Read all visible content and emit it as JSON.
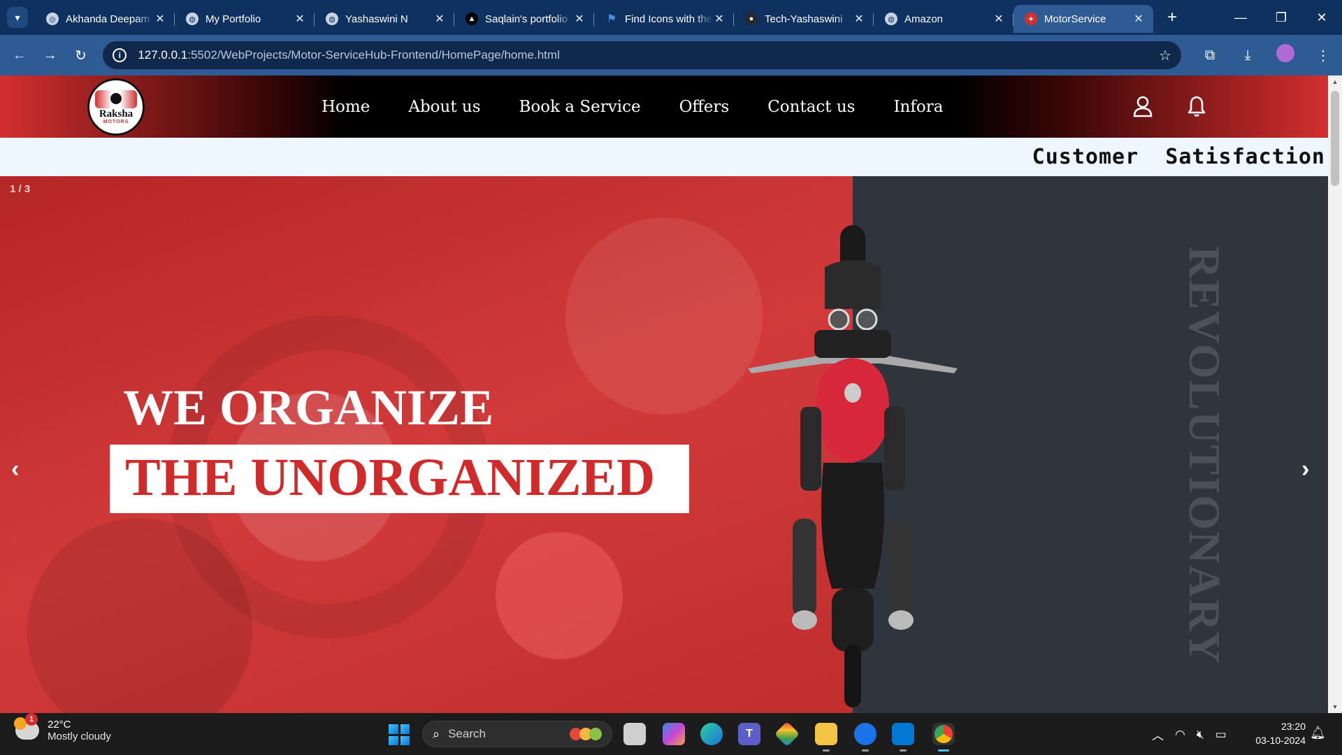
{
  "browser": {
    "tabs": [
      {
        "title": "Akhanda Deepam",
        "icon": "chatgpt-icon"
      },
      {
        "title": "My Portfolio",
        "icon": "globe-icon"
      },
      {
        "title": "Yashaswini N",
        "icon": "globe-icon"
      },
      {
        "title": "Saqlain's portfolio",
        "icon": "vercel-icon"
      },
      {
        "title": "Find Icons with the",
        "icon": "flag-icon"
      },
      {
        "title": "Tech-Yashaswini",
        "icon": "github-icon"
      },
      {
        "title": "Amazon",
        "icon": "globe-icon"
      },
      {
        "title": "MotorService",
        "icon": "site-logo-icon",
        "active": true
      }
    ],
    "url_host": "127.0.0.1",
    "url_rest": ":5502/WebProjects/Motor-ServiceHub-Frontend/HomePage/home.html"
  },
  "site": {
    "logo_text": "Raksha",
    "logo_subtext": "MOTORS",
    "nav": [
      "Home",
      "About us",
      "Book a Service",
      "Offers",
      "Contact us",
      "Infora"
    ],
    "ticker_text": "Customer  Satisfaction",
    "slide_counter": "1 / 3",
    "hero_line1": "WE ORGANIZE",
    "hero_line2": "THE UNORGANIZED",
    "hero_vertical_word": "REVOLUTIONARY",
    "prev_arrow": "‹",
    "next_arrow": "›",
    "colors": {
      "brand_red": "#d32f2f",
      "hero_dark": "#2f353d"
    }
  },
  "taskbar": {
    "weather_temp": "22°C",
    "weather_desc": "Mostly cloudy",
    "weather_badge": "1",
    "search_label": "Search",
    "time": "23:20",
    "date": "03-10-2024"
  }
}
